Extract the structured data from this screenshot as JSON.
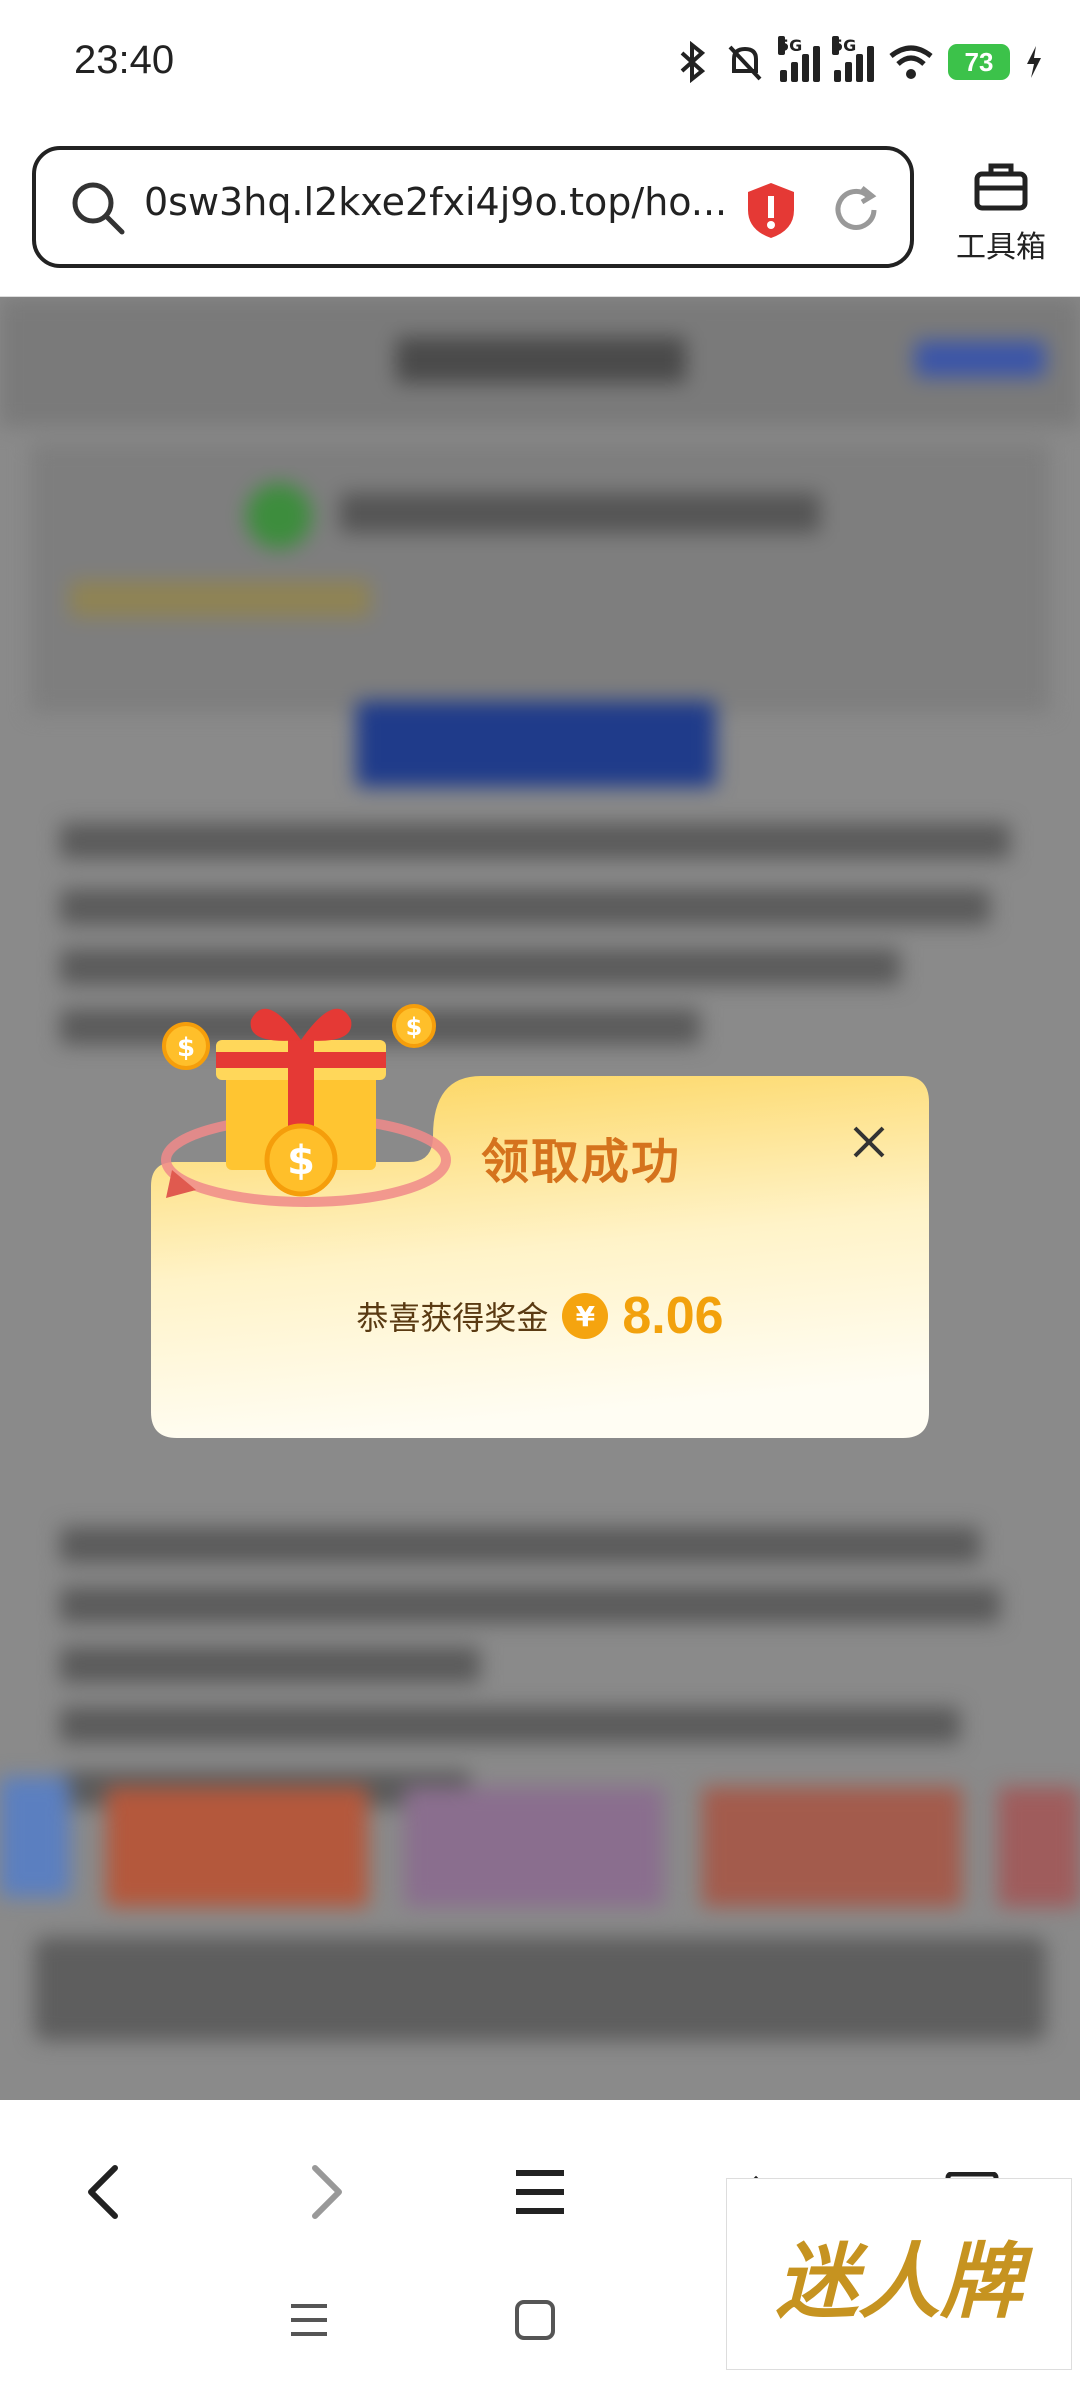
{
  "status_bar": {
    "time": "23:40",
    "net1": "5G",
    "net2": "5G",
    "battery": "73"
  },
  "browser": {
    "url": "0sw3hq.l2kxe2fxi4j9o.top/ho...",
    "toolbox_label": "工具箱"
  },
  "popup": {
    "title": "领取成功",
    "prize_text": "恭喜获得奖金",
    "currency_symbol": "¥",
    "amount": "8.06"
  },
  "colors": {
    "accent_orange": "#d5731d",
    "amount_gold": "#f2a10c",
    "battery_green": "#3cc24a",
    "shield_red": "#e53935"
  },
  "watermark": {
    "text": "迷人牌"
  }
}
